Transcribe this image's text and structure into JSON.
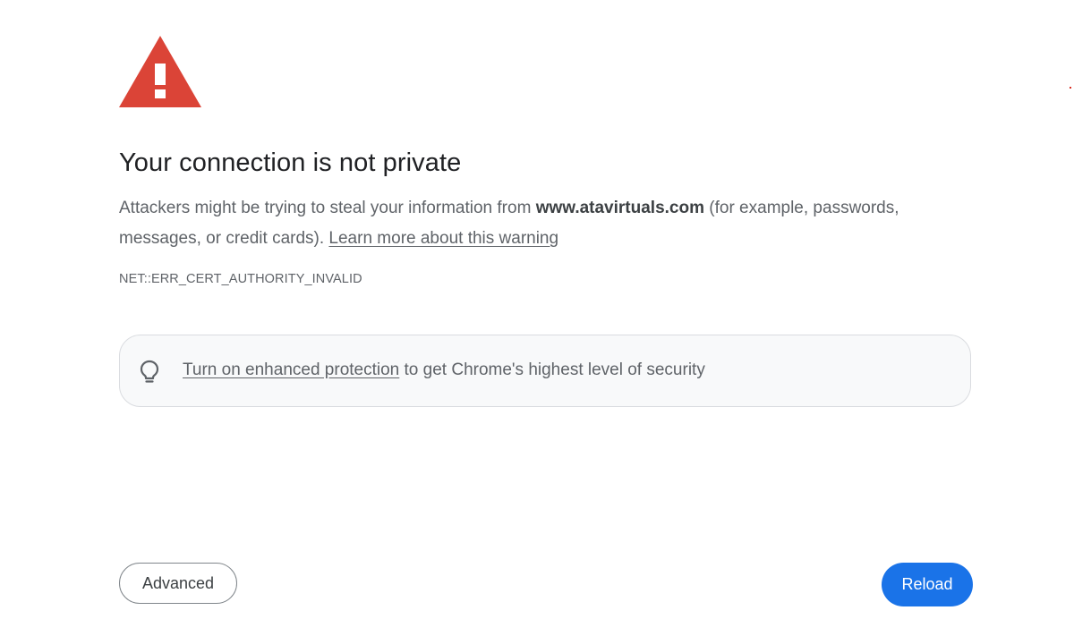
{
  "page": {
    "title": "Your connection is not private",
    "description": {
      "before_domain": "Attackers might be trying to steal your information from ",
      "domain": "www.atavirtuals.com",
      "after_domain": " (for example, passwords, messages, or credit cards). ",
      "learn_more_link": "Learn more about this warning"
    },
    "error_code": "NET::ERR_CERT_AUTHORITY_INVALID"
  },
  "protection_banner": {
    "link_text": "Turn on enhanced protection",
    "rest_text": " to get Chrome's highest level of security",
    "icon": "lightbulb-icon"
  },
  "buttons": {
    "advanced_label": "Advanced",
    "reload_label": "Reload"
  },
  "icons": {
    "warning": "warning-triangle-icon"
  },
  "colors": {
    "warning_red": "#db4437",
    "primary_blue": "#1a73e8",
    "text_secondary": "#5f6368",
    "banner_background": "#f8f9fa"
  }
}
